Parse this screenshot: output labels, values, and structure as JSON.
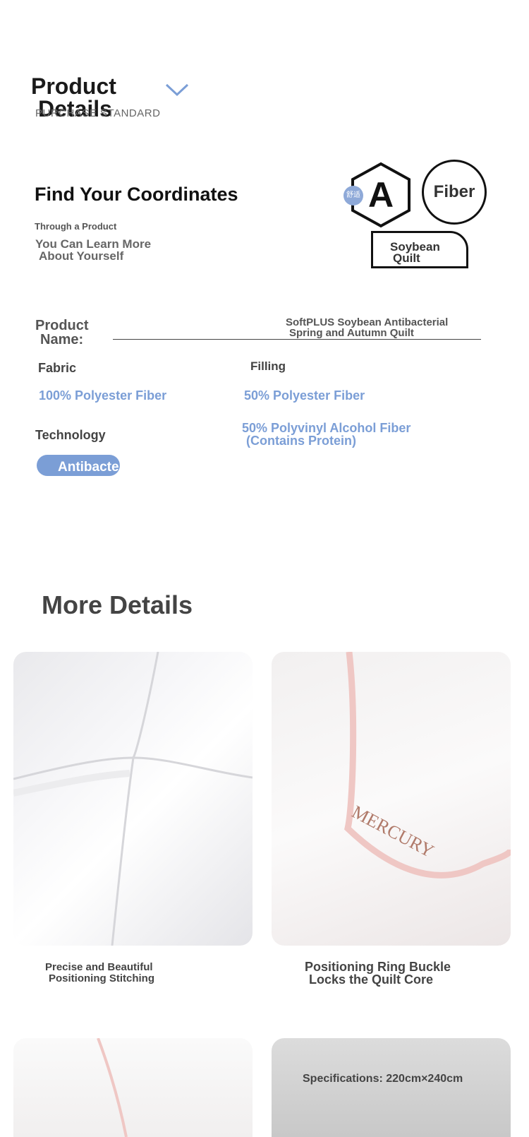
{
  "header": {
    "title_line1": "Product",
    "title_line2": "Details",
    "subtitle": "PURCHASE STANDARD"
  },
  "coordinates": {
    "title": "Find Your Coordinates",
    "line1": "Through a Product",
    "line2a": "You Can Learn More",
    "line2b": "About Yourself",
    "badge_small": "舒适",
    "badge_grade": "A",
    "badge_fiber": "Fiber",
    "badge_quilt_a": "Soybean",
    "badge_quilt_b": "Quilt"
  },
  "product": {
    "name_label_a": "Product",
    "name_label_b": "Name:",
    "name_value_a": "SoftPLUS Soybean Antibacterial",
    "name_value_b": "Spring and Autumn Quilt",
    "fabric_label": "Fabric",
    "fabric_value": "100% Polyester Fiber",
    "filling_label": "Filling",
    "filling_value1": "50% Polyester Fiber",
    "filling_value2a": "50% Polyvinyl Alcohol Fiber",
    "filling_value2b": "(Contains Protein)",
    "technology_label": "Technology",
    "technology_value": "Antibacterial"
  },
  "more": {
    "title": "More Details",
    "caption1a": "Precise and Beautiful",
    "caption1b": "Positioning Stitching",
    "caption2a": "Positioning Ring Buckle",
    "caption2b": "Locks the Quilt Core",
    "photo2_label": "MERCURY",
    "spec": "Specifications: 220cm×240cm"
  },
  "colors": {
    "accent_blue": "#7b9ed6",
    "text_dark": "#111111"
  }
}
